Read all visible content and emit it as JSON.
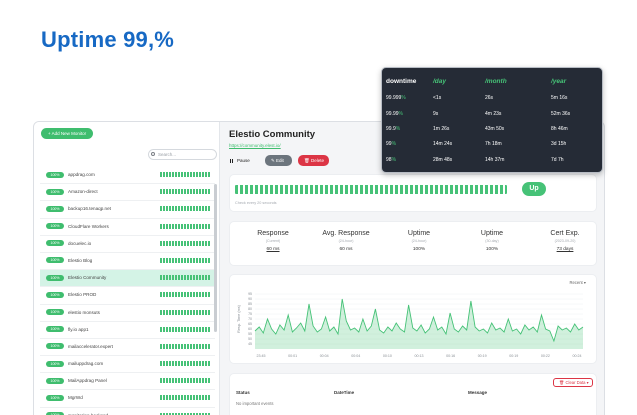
{
  "headline": "Uptime 99,%",
  "sidebar": {
    "add_button": "+ Add New Monitor",
    "search_placeholder": "Search...",
    "monitors": [
      {
        "badge": "100%",
        "name": "appdrag.com",
        "selected": false
      },
      {
        "badge": "100%",
        "name": "Amazon-direct",
        "selected": false
      },
      {
        "badge": "100%",
        "name": "backup16.tenaqp.net",
        "selected": false
      },
      {
        "badge": "100%",
        "name": "CloudFlare Workers",
        "selected": false
      },
      {
        "badge": "100%",
        "name": "docuelec.io",
        "selected": false
      },
      {
        "badge": "100%",
        "name": "Elestio Blog",
        "selected": false
      },
      {
        "badge": "100%",
        "name": "Elestio Community",
        "selected": true
      },
      {
        "badge": "100%",
        "name": "Elestio PROD",
        "selected": false
      },
      {
        "badge": "100%",
        "name": "elestio monsuts",
        "selected": false
      },
      {
        "badge": "100%",
        "name": "fly.io app1",
        "selected": false
      },
      {
        "badge": "100%",
        "name": "mailaccelerator.expert",
        "selected": false
      },
      {
        "badge": "100%",
        "name": "mailuppdrag.com",
        "selected": false
      },
      {
        "badge": "100%",
        "name": "MailAppdrag Panel",
        "selected": false
      },
      {
        "badge": "100%",
        "name": "MgrWd",
        "selected": false
      },
      {
        "badge": "100%",
        "name": "monitoring-backend",
        "selected": false
      }
    ]
  },
  "monitor": {
    "title": "Elestio Community",
    "url": "https://community.elest.io/",
    "pause_label": "Pause",
    "edit_label": "Edit",
    "delete_label": "Delete",
    "status_label": "Up",
    "heartbeat_note": "Check every 20 seconds"
  },
  "stats": [
    {
      "title": "Response",
      "sub": "(Current)",
      "value": "60 ms",
      "underline": true
    },
    {
      "title": "Avg. Response",
      "sub": "(24-hour)",
      "value": "60 ms",
      "underline": false
    },
    {
      "title": "Uptime",
      "sub": "(24-hour)",
      "value": "100%",
      "underline": false
    },
    {
      "title": "Uptime",
      "sub": "(30-day)",
      "value": "100%",
      "underline": false
    },
    {
      "title": "Cert Exp.",
      "sub": "(2023-09-20)",
      "value": "73 days",
      "underline": true
    }
  ],
  "chart": {
    "period_label": "Recent",
    "ylabel": "Resp. Time (ms)"
  },
  "chart_data": {
    "type": "area",
    "ylim": [
      40,
      100
    ],
    "yticks": [
      45,
      50,
      55,
      60,
      65,
      70,
      75,
      80,
      85,
      90,
      95
    ],
    "xticks": [
      "23:45",
      "00:01",
      "00:04",
      "00:04",
      "00:10",
      "00:13",
      "00:16",
      "00:19",
      "00:19",
      "00:22",
      "00:24"
    ],
    "series": [
      {
        "values": [
          58,
          62,
          56,
          70,
          60,
          55,
          64,
          59,
          74,
          57,
          61,
          66,
          58,
          85,
          63,
          57,
          60,
          72,
          58,
          62,
          55,
          90,
          68,
          59,
          61,
          57,
          70,
          58,
          63,
          80,
          59,
          56,
          62,
          58,
          66,
          60,
          57,
          84,
          61,
          58,
          64,
          56,
          60,
          72,
          59,
          62,
          55,
          76,
          60,
          57,
          63,
          59,
          88,
          62,
          58,
          60,
          56,
          66,
          59,
          61,
          57,
          70,
          58,
          60,
          55,
          64,
          59,
          62,
          57,
          74,
          60,
          58,
          48,
          63,
          59,
          61,
          57,
          65,
          59,
          62
        ]
      }
    ],
    "grid": true,
    "color": "#46c277"
  },
  "events": {
    "clear_label": "Clear Data",
    "columns": [
      "Status",
      "DateTime",
      "Message"
    ],
    "empty_text": "No important events"
  },
  "uptime_table": {
    "headers": [
      "downtime",
      "/day",
      "/month",
      "/year"
    ],
    "rows": [
      {
        "pct_main": "99.999",
        "pct_green": "%",
        "day": "<1s",
        "month": "26s",
        "year": "5m 16s"
      },
      {
        "pct_main": "99.99",
        "pct_green": "%",
        "day": "9s",
        "month": "4m 23s",
        "year": "52m 36s"
      },
      {
        "pct_main": "99.9",
        "pct_green": "%",
        "day": "1m 26s",
        "month": "43m 50s",
        "year": "8h 46m"
      },
      {
        "pct_main": "99",
        "pct_green": "%",
        "day": "14m 24s",
        "month": "7h 18m",
        "year": "3d 15h"
      },
      {
        "pct_main": "98",
        "pct_green": "%",
        "day": "28m 48s",
        "month": "14h 37m",
        "year": "7d 7h"
      }
    ]
  }
}
